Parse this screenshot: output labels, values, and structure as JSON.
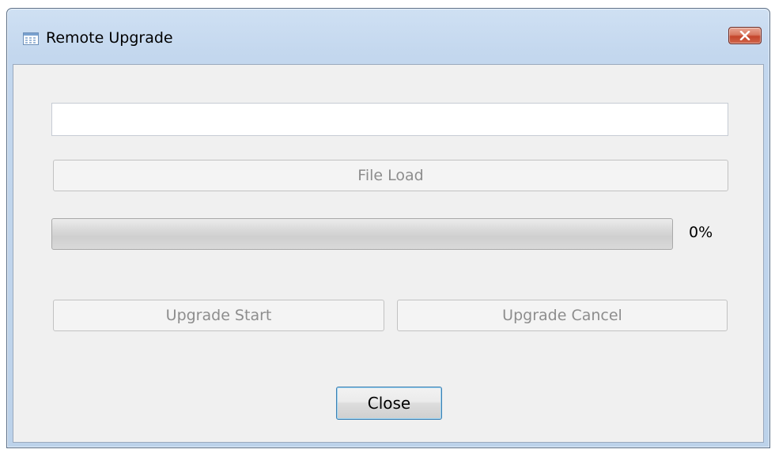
{
  "window": {
    "title": "Remote Upgrade",
    "title_icon": "app-window-icon",
    "close_icon": "close-icon"
  },
  "form": {
    "file_path_value": "",
    "file_load_label": "File Load",
    "progress_percent": 0,
    "progress_text": "0%",
    "upgrade_start_label": "Upgrade Start",
    "upgrade_cancel_label": "Upgrade Cancel",
    "close_label": "Close"
  },
  "colors": {
    "title_bar": "#c3d7ee",
    "client_bg": "#f0f0f0",
    "close_button_red": "#c4442b",
    "disabled_text": "#8d8d8d",
    "focus_border": "#3c7fb1"
  }
}
